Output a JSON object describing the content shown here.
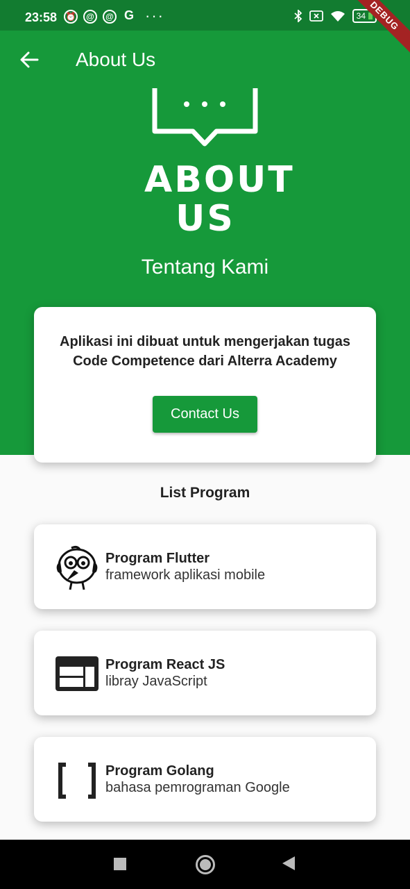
{
  "status_bar": {
    "time": "23:58",
    "notification_icons": [
      "alarm-icon",
      "at-icon",
      "at-icon",
      "google-icon"
    ],
    "more": "···",
    "right_icons": [
      "bluetooth-icon",
      "sim-off-icon",
      "wifi-icon"
    ],
    "battery": "34",
    "debug_banner": "DEBUG"
  },
  "app_bar": {
    "title": "About Us",
    "back_icon": "arrow-left-icon"
  },
  "hero": {
    "logo_text": [
      "ABOUT",
      "US"
    ],
    "subtitle": "Tentang Kami"
  },
  "intro_card": {
    "text": "Aplikasi ini dibuat untuk mengerjakan tugas Code Competence dari Alterra Academy",
    "button_label": "Contact Us"
  },
  "list_title": "List Program",
  "programs": [
    {
      "title": "Program Flutter",
      "subtitle": "framework aplikasi mobile",
      "icon": "flutter-mascot-icon"
    },
    {
      "title": "Program React JS",
      "subtitle": "libray JavaScript",
      "icon": "layout-icon"
    },
    {
      "title": "Program Golang",
      "subtitle": "bahasa pemrograman Google",
      "icon": "brackets-icon"
    }
  ],
  "colors": {
    "primary": "#16993a",
    "status_bar": "#127c30",
    "background": "#fafafa"
  }
}
